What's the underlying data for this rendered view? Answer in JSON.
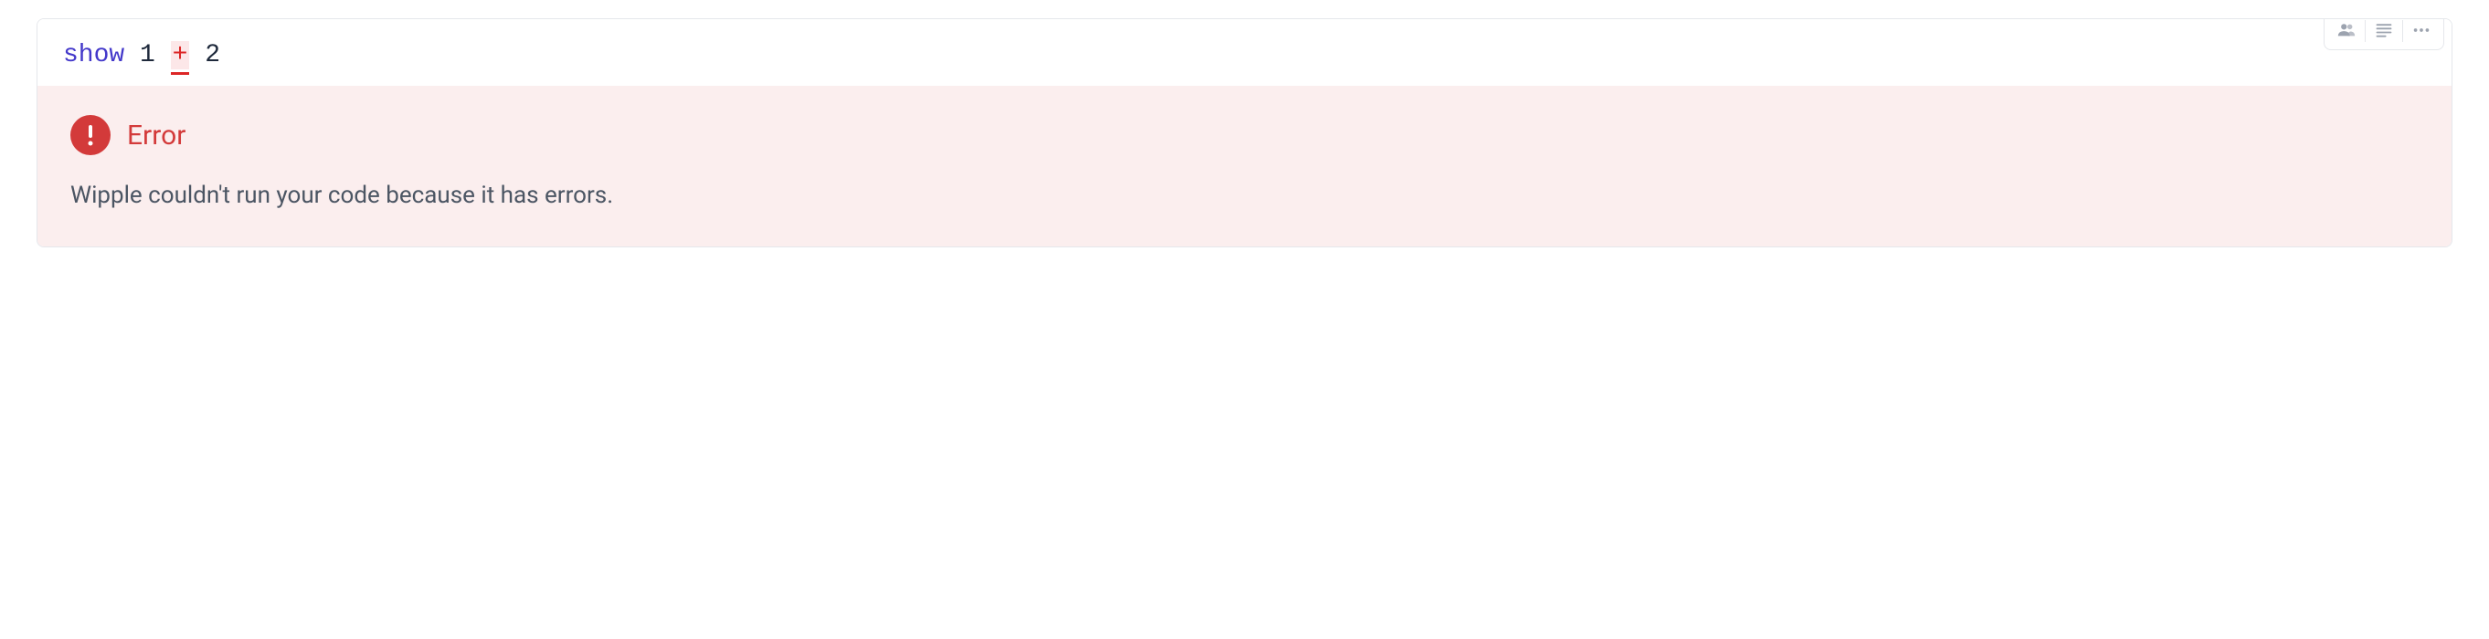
{
  "code": {
    "keyword": "show",
    "operand1": "1",
    "operator": "+",
    "operand2": "2"
  },
  "error": {
    "title": "Error",
    "message": "Wipple couldn't run your code because it has errors."
  },
  "icons": {
    "people": "people-icon",
    "lines": "lines-icon",
    "more": "more-icon",
    "alert": "alert-icon"
  }
}
